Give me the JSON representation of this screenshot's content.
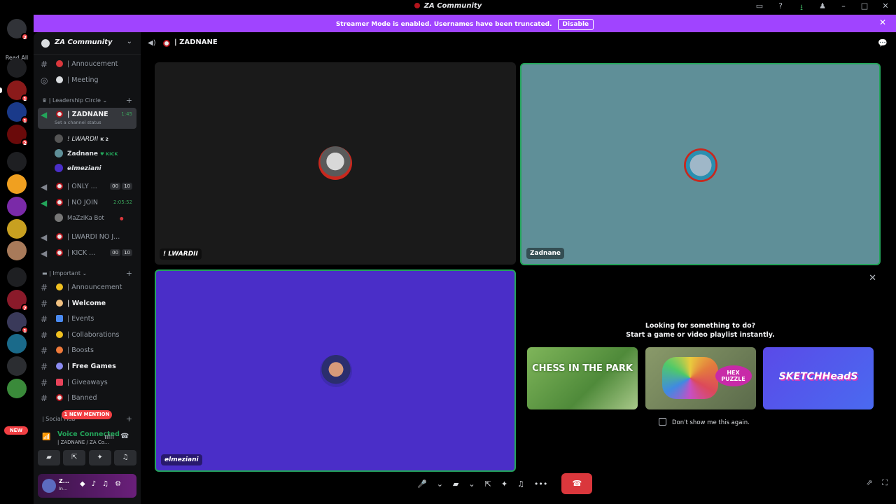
{
  "window": {
    "title": "ZA Community"
  },
  "guilds": {
    "read_all": "Read All",
    "new_label": "NEW"
  },
  "banner": {
    "text": "Streamer Mode is enabled. Usernames have been truncated.",
    "button": "Disable"
  },
  "server": {
    "name": "ZA Community"
  },
  "channels": [
    {
      "label": "| Annoucement"
    },
    {
      "label": "| Meeting"
    }
  ],
  "leadership": {
    "category": "| Leadership Circle"
  },
  "voice": {
    "zadnane": {
      "label": "| ZADNANE",
      "time": "1:45",
      "status": "Set a channel status"
    },
    "members": [
      {
        "name": "! LWARDII",
        "tag": "K 2"
      },
      {
        "name": "Zadnane",
        "tag": "KICK"
      },
      {
        "name": "elmeziani",
        "tag": ""
      }
    ],
    "only": {
      "label": "| ONLY ...",
      "c1": "00",
      "c2": "10"
    },
    "nojoin": {
      "label": "| NO JOIN",
      "time": "2:05:52"
    },
    "bot": {
      "name": "MaZziKa Bot"
    },
    "lwardi": {
      "label": "| LWARDI NO J..."
    },
    "kick": {
      "label": "| KICK ...",
      "c1": "00",
      "c2": "10"
    }
  },
  "important": {
    "category": "| Important",
    "items": [
      {
        "label": "| Announcement"
      },
      {
        "label": "| Welcome"
      },
      {
        "label": "| Events"
      },
      {
        "label": "| Collaborations"
      },
      {
        "label": "| Boosts"
      },
      {
        "label": "| Free  Games"
      },
      {
        "label": "| Giveaways"
      },
      {
        "label": "| Banned"
      }
    ],
    "next_category": "| Social Hub",
    "mention": "1 NEW MENTION"
  },
  "voice_panel": {
    "connected": "Voice Connected",
    "where": "| ZADNANE / ZA Co..."
  },
  "user": {
    "name": "Z...",
    "status": "In..."
  },
  "header": {
    "channel": "| ZADNANE"
  },
  "tiles": [
    {
      "name": "! LWARDII"
    },
    {
      "name": "Zadnane"
    },
    {
      "name": "elmeziani"
    }
  ],
  "activity": {
    "line1": "Looking for something to do?",
    "line2": "Start a game or video playlist instantly.",
    "cards": [
      {
        "title": "CHESS IN THE PARK"
      },
      {
        "title": "HEX PUZZLE"
      },
      {
        "title": "SKETCHHeadS"
      }
    ],
    "checkbox": "Don't show me this again."
  },
  "colors": {
    "accent": "#a044ff",
    "connected": "#23a55a",
    "danger": "#da373c"
  }
}
